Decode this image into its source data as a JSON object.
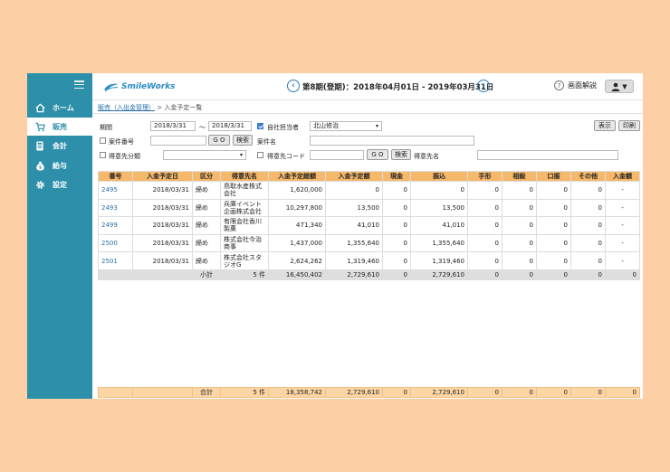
{
  "app": {
    "logo": "SmileWorks",
    "period": "第8期(登期)：2018年04月01日 - 2019年03月31日",
    "help": "画面解説"
  },
  "sidebar": {
    "items": [
      {
        "label": "ホーム",
        "icon": "home-icon"
      },
      {
        "label": "販売",
        "icon": "cart-icon"
      },
      {
        "label": "会計",
        "icon": "ledger-icon"
      },
      {
        "label": "給与",
        "icon": "money-bag-icon"
      },
      {
        "label": "設定",
        "icon": "gear-icon"
      }
    ]
  },
  "breadcrumb": {
    "parent": "販売（入出金管理）",
    "sep": ">",
    "current": "入金予定一覧"
  },
  "filters": {
    "period_label": "期間",
    "date_from": "2018/3/31",
    "tilde": "～",
    "date_to": "2018/3/31",
    "own_staff_label": "自社担当者",
    "own_staff_value": "北山修治",
    "case_no_label": "案件番号",
    "go": "G O",
    "search": "検索",
    "case_name_label": "案件名",
    "customer_cat_label": "得意先分類",
    "customer_code_label": "得意先コード",
    "customer_name_label": "得意先名",
    "display_btn": "表示",
    "print_btn": "印刷"
  },
  "table": {
    "headers": [
      "番号",
      "入金予定日",
      "区分",
      "得意先名",
      "入金予定総額",
      "入金予定額",
      "現金",
      "振込",
      "手形",
      "相殺",
      "口振",
      "その他",
      "入金額"
    ],
    "rows": [
      {
        "no": "2495",
        "date": "2018/03/31",
        "kubun": "締め",
        "customer": "鳥取水産株式会社",
        "total": "1,620,000",
        "planned": "0",
        "cash": "0",
        "transfer": "0",
        "bill": "0",
        "offset": "0",
        "debit": "0",
        "other": "0",
        "received": "-"
      },
      {
        "no": "2493",
        "date": "2018/03/31",
        "kubun": "締め",
        "customer": "兵庫イベント企画株式会社",
        "total": "10,297,800",
        "planned": "13,500",
        "cash": "0",
        "transfer": "13,500",
        "bill": "0",
        "offset": "0",
        "debit": "0",
        "other": "0",
        "received": "-"
      },
      {
        "no": "2499",
        "date": "2018/03/31",
        "kubun": "締め",
        "customer": "有限会社香川製菓",
        "total": "471,340",
        "planned": "41,010",
        "cash": "0",
        "transfer": "41,010",
        "bill": "0",
        "offset": "0",
        "debit": "0",
        "other": "0",
        "received": "-"
      },
      {
        "no": "2500",
        "date": "2018/03/31",
        "kubun": "締め",
        "customer": "株式会社今治商事",
        "total": "1,437,000",
        "planned": "1,355,640",
        "cash": "0",
        "transfer": "1,355,640",
        "bill": "0",
        "offset": "0",
        "debit": "0",
        "other": "0",
        "received": "-"
      },
      {
        "no": "2501",
        "date": "2018/03/31",
        "kubun": "締め",
        "customer": "株式会社スタジオG",
        "total": "2,624,262",
        "planned": "1,319,460",
        "cash": "0",
        "transfer": "1,319,460",
        "bill": "0",
        "offset": "0",
        "debit": "0",
        "other": "0",
        "received": "-"
      }
    ],
    "subtotal": {
      "label": "小計",
      "count": "5 件",
      "total": "16,450,402",
      "planned": "2,729,610",
      "cash": "0",
      "transfer": "2,729,610",
      "bill": "0",
      "offset": "0",
      "debit": "0",
      "other": "0",
      "received": "0"
    },
    "grandtotal": {
      "label": "合計",
      "count": "5 件",
      "total": "18,358,742",
      "planned": "2,729,610",
      "cash": "0",
      "transfer": "2,729,610",
      "bill": "0",
      "offset": "0",
      "debit": "0",
      "other": "0",
      "received": "0"
    }
  }
}
